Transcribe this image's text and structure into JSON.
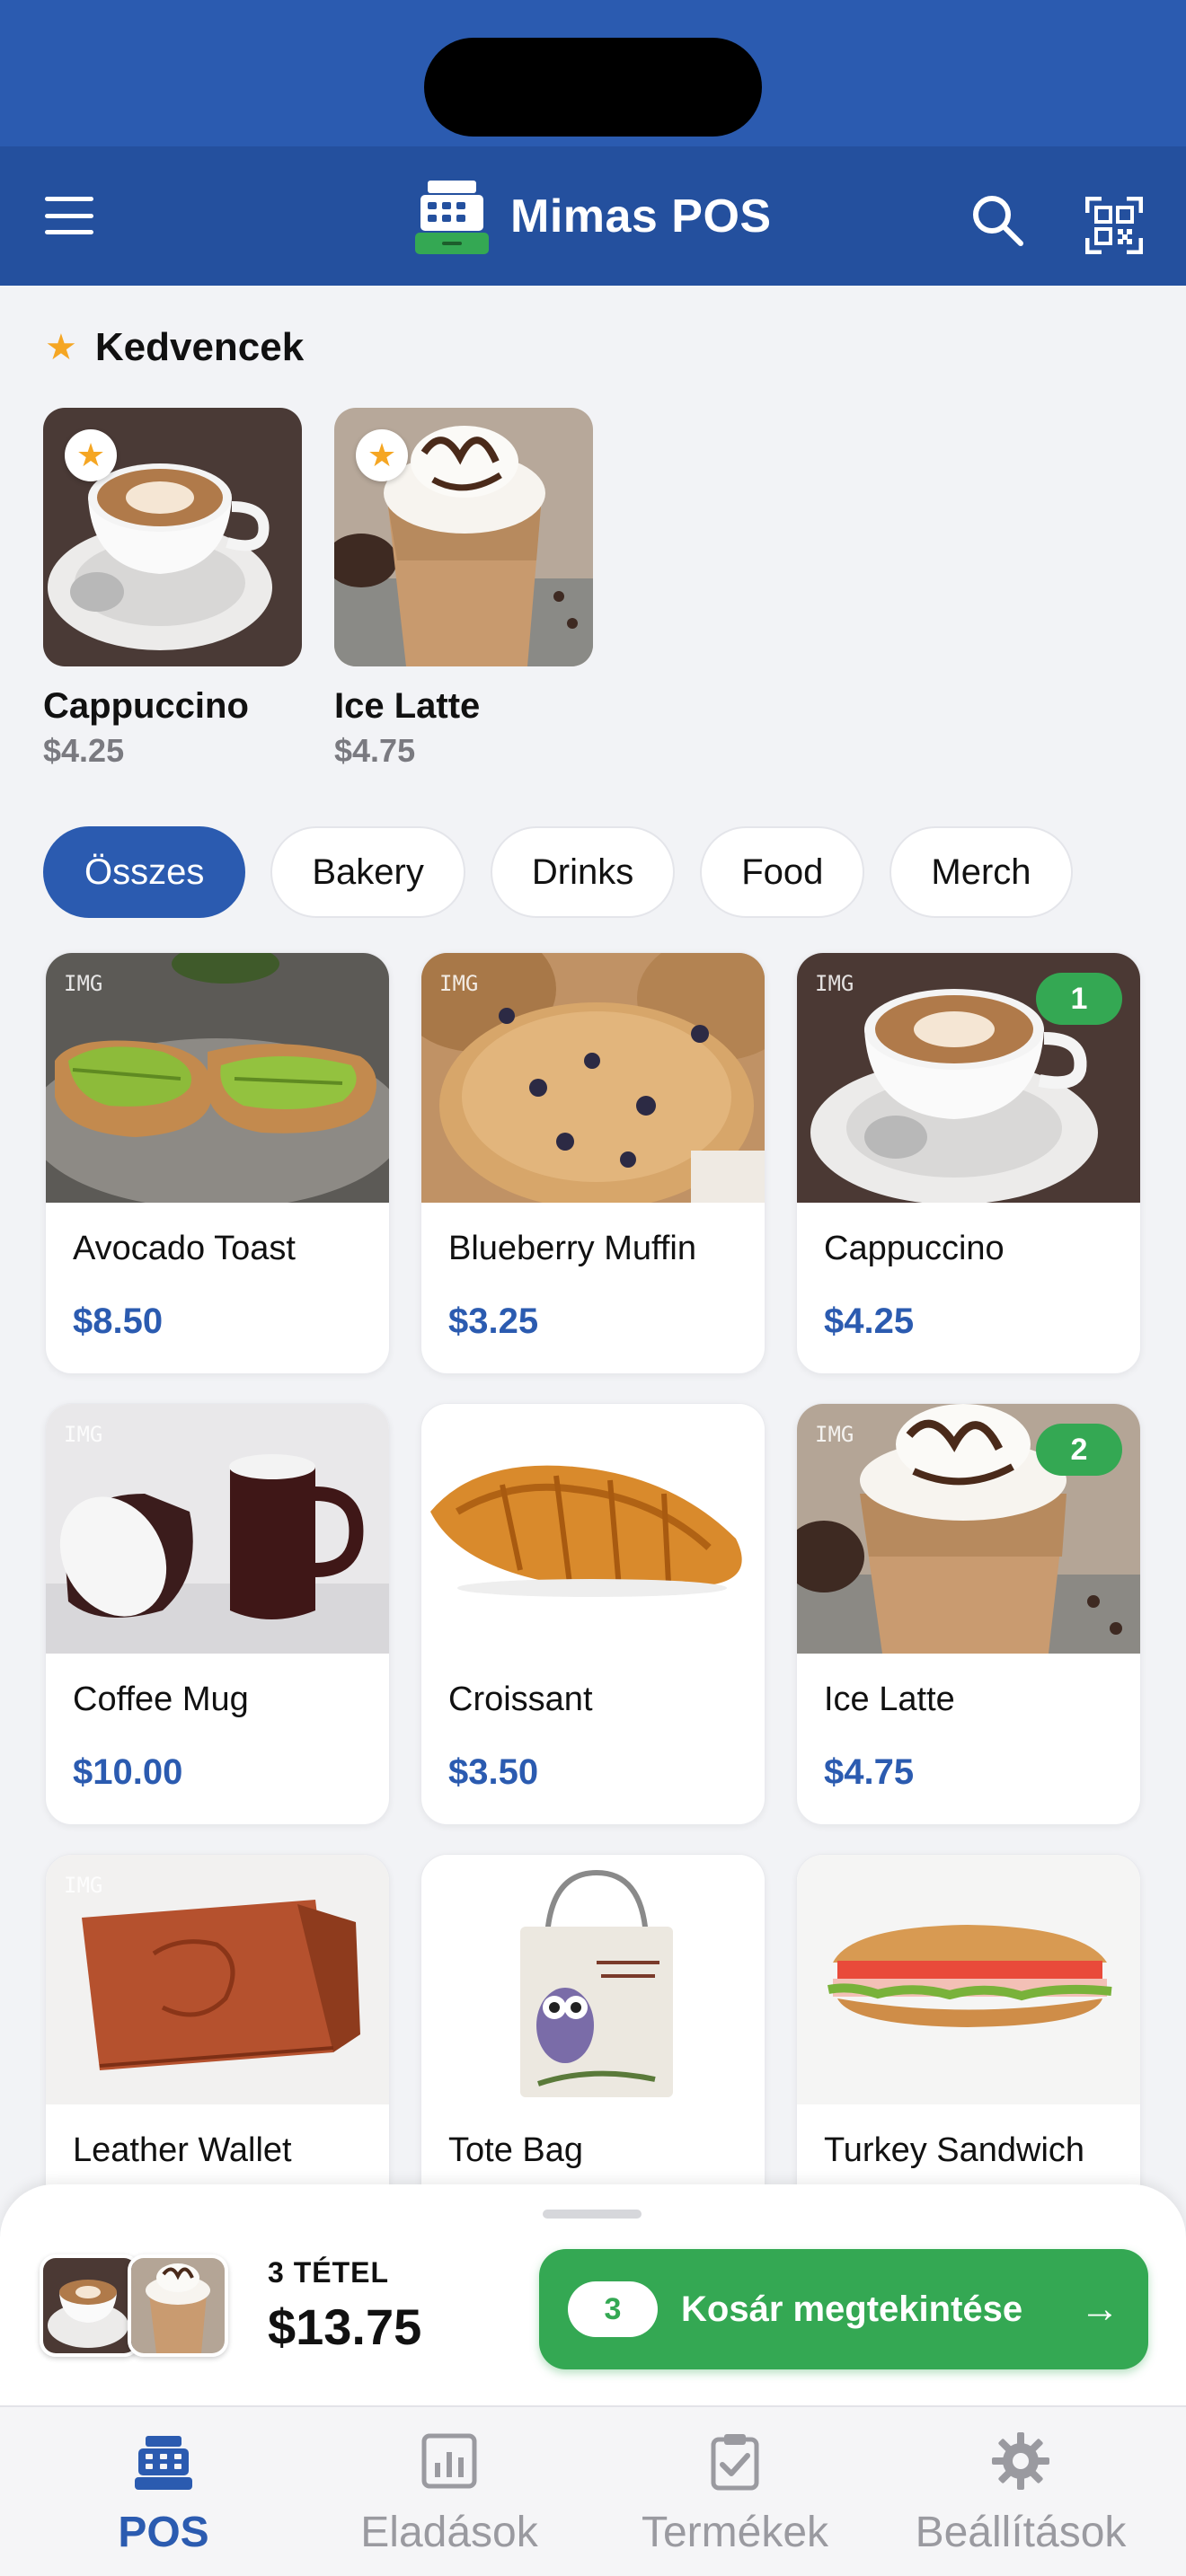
{
  "app": {
    "title": "Mimas POS"
  },
  "icons": {
    "menu": "hamburger-icon",
    "logo": "cash-register-icon",
    "search": "search-icon",
    "qr": "qr-code-icon",
    "favorite": "star-icon",
    "arrow": "arrow-right-icon"
  },
  "favorites": {
    "title": "Kedvencek",
    "items": [
      {
        "name": "Cappuccino",
        "price": "$4.25"
      },
      {
        "name": "Ice Latte",
        "price": "$4.75"
      }
    ]
  },
  "categories": [
    {
      "label": "Összes",
      "active": true
    },
    {
      "label": "Bakery",
      "active": false
    },
    {
      "label": "Drinks",
      "active": false
    },
    {
      "label": "Food",
      "active": false
    },
    {
      "label": "Merch",
      "active": false
    }
  ],
  "img_tag": "IMG",
  "products": [
    {
      "name": "Avocado Toast",
      "price": "$8.50",
      "in_cart": ""
    },
    {
      "name": "Blueberry Muffin",
      "price": "$3.25",
      "in_cart": ""
    },
    {
      "name": "Cappuccino",
      "price": "$4.25",
      "in_cart": "1"
    },
    {
      "name": "Coffee Mug",
      "price": "$10.00",
      "in_cart": ""
    },
    {
      "name": "Croissant",
      "price": "$3.50",
      "in_cart": ""
    },
    {
      "name": "Ice Latte",
      "price": "$4.75",
      "in_cart": "2"
    },
    {
      "name": "Leather Wallet",
      "price": "",
      "in_cart": ""
    },
    {
      "name": "Tote Bag",
      "price": "",
      "in_cart": ""
    },
    {
      "name": "Turkey Sandwich",
      "price": "",
      "in_cart": ""
    }
  ],
  "cart_summary": {
    "items_label": "3 TÉTEL",
    "total": "$13.75",
    "count": "3",
    "button_label": "Kosár megtekintése",
    "arrow": "→"
  },
  "tabs": [
    {
      "label": "POS",
      "active": true
    },
    {
      "label": "Eladások",
      "active": false
    },
    {
      "label": "Termékek",
      "active": false
    },
    {
      "label": "Beállítások",
      "active": false
    }
  ],
  "colors": {
    "primary": "#2b5bb0",
    "appbar": "#24509e",
    "accent_green": "#34a853",
    "favorite_star": "#f5a623"
  }
}
